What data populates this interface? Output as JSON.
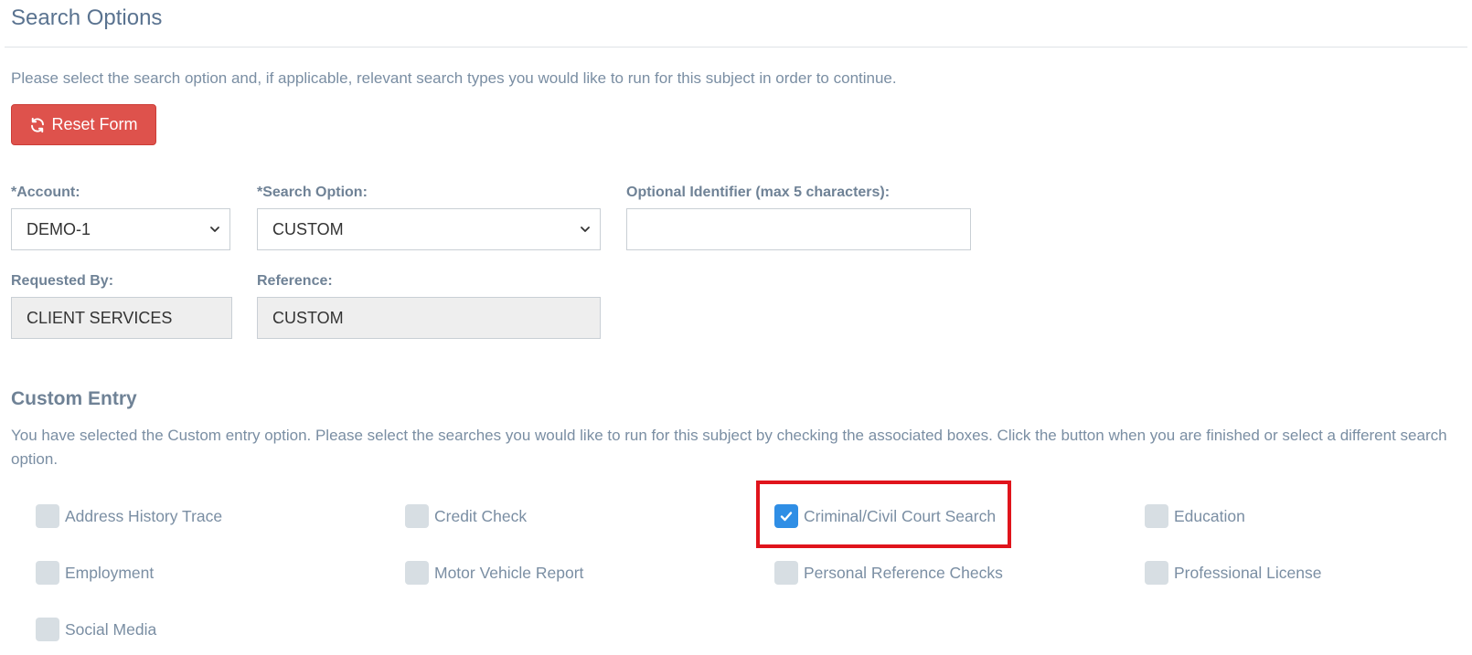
{
  "page": {
    "title": "Search Options",
    "intro": "Please select the search option and, if applicable, relevant search types you would like to run for this subject in order to continue."
  },
  "reset_button": {
    "label": "Reset Form",
    "color": "#de524c"
  },
  "fields": {
    "account": {
      "label": "*Account:",
      "value": "DEMO-1"
    },
    "search_option": {
      "label": "*Search Option:",
      "value": "CUSTOM"
    },
    "optional_identifier": {
      "label": "Optional Identifier (max 5 characters):",
      "value": ""
    },
    "requested_by": {
      "label": "Requested By:",
      "value": "CLIENT SERVICES"
    },
    "reference": {
      "label": "Reference:",
      "value": "CUSTOM"
    }
  },
  "custom_entry": {
    "title": "Custom Entry",
    "description": "You have selected the Custom entry option. Please select the searches you would like to run for this subject by checking the associated boxes. Click the button when you are finished or select a different search option.",
    "options": [
      {
        "label": "Address History Trace",
        "checked": false
      },
      {
        "label": "Credit Check",
        "checked": false
      },
      {
        "label": "Criminal/Civil Court Search",
        "checked": true
      },
      {
        "label": "Education",
        "checked": false
      },
      {
        "label": "Employment",
        "checked": false
      },
      {
        "label": "Motor Vehicle Report",
        "checked": false
      },
      {
        "label": "Personal Reference Checks",
        "checked": false
      },
      {
        "label": "Professional License",
        "checked": false
      },
      {
        "label": "Social Media",
        "checked": false
      }
    ]
  },
  "colors": {
    "checked": "#2f8ee5",
    "unchecked": "#d7dee3",
    "highlight": "#e0141c"
  },
  "icons": {
    "reset": "refresh-icon",
    "select": "chevron-down-icon",
    "check": "checkmark-icon"
  }
}
